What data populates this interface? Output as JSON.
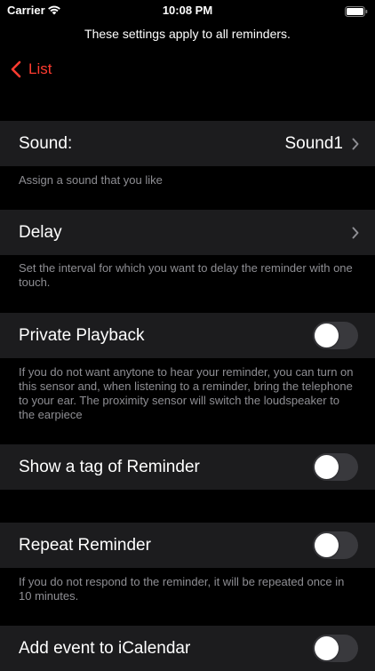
{
  "status_bar": {
    "carrier": "Carrier",
    "time": "10:08 PM"
  },
  "header_note": "These settings apply to all reminders.",
  "nav": {
    "back_label": "List"
  },
  "colors": {
    "accent": "#ff3b30",
    "cell_background": "#1c1c1e",
    "footer_text": "#8e8e93",
    "toggle_off": "#39393d"
  },
  "settings": {
    "sound": {
      "label": "Sound:",
      "value": "Sound1",
      "footer": "Assign a sound that you like"
    },
    "delay": {
      "label": "Delay",
      "footer": "Set the interval for which you want to delay the reminder with one touch."
    },
    "private_playback": {
      "label": "Private Playback",
      "enabled": false,
      "footer": "If you do not want anytone to hear your reminder, you can turn on this sensor and, when listening to a reminder, bring the telephone to your ear. The proximity sensor will switch the loudspeaker to the earpiece"
    },
    "show_tag": {
      "label": "Show a tag of Reminder",
      "enabled": false
    },
    "repeat": {
      "label": "Repeat Reminder",
      "enabled": false,
      "footer": "If you do not respond to the reminder, it will be repeated once in 10 minutes."
    },
    "icalendar": {
      "label": "Add event to iCalendar",
      "enabled": false
    }
  },
  "icons": {
    "wifi": "wifi-icon",
    "battery": "battery-icon",
    "back": "chevron-left-icon",
    "disclosure": "chevron-right-icon"
  }
}
